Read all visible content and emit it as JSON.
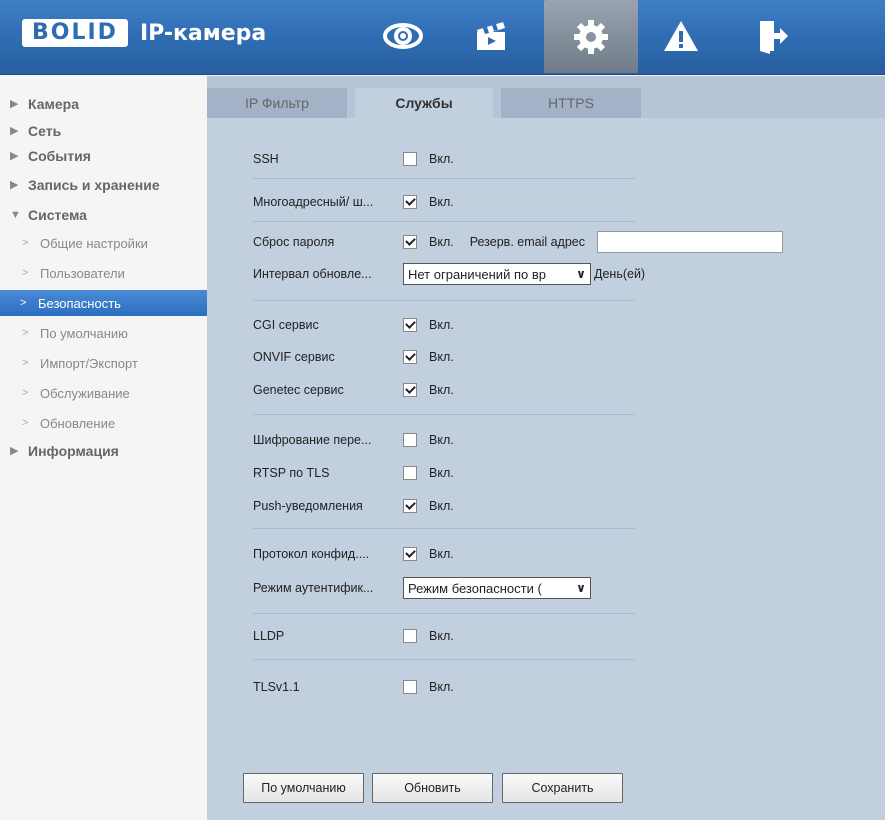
{
  "header": {
    "logo_text": "BOLID",
    "app_title": "IP-камера",
    "nav_icons": [
      "eye-icon",
      "clapperboard-icon",
      "gear-icon",
      "warning-icon",
      "logout-icon"
    ]
  },
  "sidebar": {
    "items": [
      {
        "label": "Камера",
        "type": "top",
        "expanded": false
      },
      {
        "label": "Сеть",
        "type": "top",
        "expanded": false
      },
      {
        "label": "События",
        "type": "top",
        "expanded": false
      },
      {
        "label": "Запись и хранение",
        "type": "top",
        "expanded": false
      },
      {
        "label": "Система",
        "type": "top",
        "expanded": true
      },
      {
        "label": "Общие настройки",
        "type": "sub"
      },
      {
        "label": "Пользователи",
        "type": "sub"
      },
      {
        "label": "Безопасность",
        "type": "sub",
        "active": true
      },
      {
        "label": "По умолчанию",
        "type": "sub"
      },
      {
        "label": "Импорт/Экспорт",
        "type": "sub"
      },
      {
        "label": "Обслуживание",
        "type": "sub"
      },
      {
        "label": "Обновление",
        "type": "sub"
      },
      {
        "label": "Информация",
        "type": "top",
        "expanded": false
      }
    ]
  },
  "tabs": [
    {
      "label": "IP Фильтр",
      "active": false
    },
    {
      "label": "Службы",
      "active": true
    },
    {
      "label": "HTTPS",
      "active": false
    }
  ],
  "form": {
    "enable_label": "Вкл.",
    "ssh": {
      "label": "SSH",
      "checked": false
    },
    "multicast": {
      "label": "Многоадресный/ ш...",
      "checked": true
    },
    "reset_password": {
      "label": "Сброс пароля",
      "checked": true,
      "email_label": "Резерв. email адрес",
      "email_value": ""
    },
    "update_interval": {
      "label": "Интервал обновле...",
      "selected": "Нет ограничений по вр",
      "unit": "День(ей)"
    },
    "cgi": {
      "label": "CGI сервис",
      "checked": true
    },
    "onvif": {
      "label": "ONVIF сервис",
      "checked": true
    },
    "genetec": {
      "label": "Genetec сервис",
      "checked": true
    },
    "encryption": {
      "label": "Шифрование пере...",
      "checked": false
    },
    "rtsp_tls": {
      "label": "RTSP по TLS",
      "checked": false
    },
    "push": {
      "label": "Push-уведомления",
      "checked": true
    },
    "privacy": {
      "label": "Протокол конфид....",
      "checked": true
    },
    "auth_mode": {
      "label": "Режим аутентифик...",
      "selected": "Режим безопасности ("
    },
    "lldp": {
      "label": "LLDP",
      "checked": false
    },
    "tls11": {
      "label": "TLSv1.1",
      "checked": false
    }
  },
  "buttons": {
    "default": "По умолчанию",
    "refresh": "Обновить",
    "save": "Сохранить"
  },
  "colors": {
    "header_blue": "#2f6db3",
    "content_bg": "#c2cfdf",
    "active_menu": "#3a7dcc"
  }
}
